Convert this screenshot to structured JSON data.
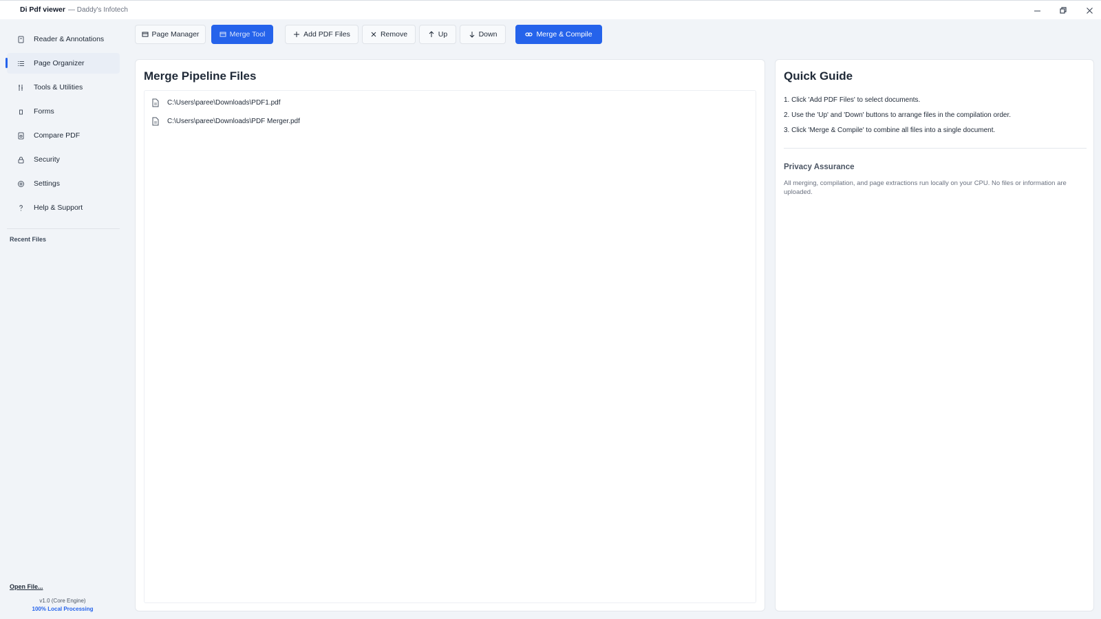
{
  "window": {
    "app_name": "Di Pdf viewer",
    "subtitle": "— Daddy's Infotech",
    "minimize_icon": "—",
    "restore_icon": "🗗",
    "close_icon": "✕"
  },
  "sidebar": {
    "items": [
      {
        "label": "Reader & Annotations",
        "icon": "book-icon",
        "active": false
      },
      {
        "label": "Page Organizer",
        "icon": "list-icon",
        "active": true
      },
      {
        "label": "Tools & Utilities",
        "icon": "tools-icon",
        "active": false
      },
      {
        "label": "Forms",
        "icon": "form-icon",
        "active": false
      },
      {
        "label": "Compare PDF",
        "icon": "compare-icon",
        "active": false
      },
      {
        "label": "Security",
        "icon": "lock-icon",
        "active": false
      },
      {
        "label": "Settings",
        "icon": "gear-icon",
        "active": false
      },
      {
        "label": "Help & Support",
        "icon": "question-icon",
        "active": false
      }
    ],
    "recent_title": "Recent Files",
    "open_file": "Open File...",
    "version": "v1.0 (Core Engine)",
    "local_processing": "100% Local Processing"
  },
  "toolbar": {
    "page_manager": "Page Manager",
    "merge_tool": "Merge Tool",
    "add_pdf": "Add PDF Files",
    "remove": "Remove",
    "up": "Up",
    "down": "Down",
    "merge_compile": "Merge & Compile"
  },
  "merge_panel": {
    "title": "Merge Pipeline Files",
    "files": [
      "C:\\Users\\paree\\Downloads\\PDF1.pdf",
      "C:\\Users\\paree\\Downloads\\PDF Merger.pdf"
    ]
  },
  "guide": {
    "title": "Quick Guide",
    "steps": [
      "1. Click 'Add PDF Files' to select documents.",
      "2. Use the 'Up' and 'Down' buttons to arrange files in the compilation order.",
      "3. Click 'Merge & Compile' to combine all files into a single document."
    ],
    "privacy_title": "Privacy Assurance",
    "privacy_text": "All merging, compilation, and page extractions run locally on your CPU. No files or information are uploaded."
  },
  "colors": {
    "accent": "#2563eb",
    "background": "#f1f4f8",
    "panel": "#ffffff"
  }
}
